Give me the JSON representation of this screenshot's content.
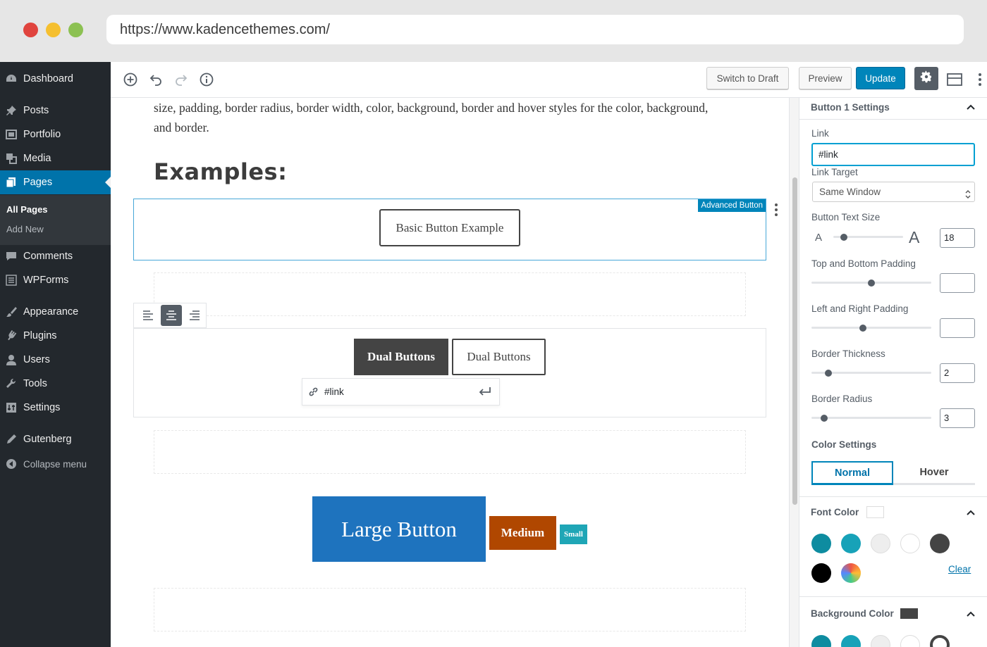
{
  "browser": {
    "url": "https://www.kadencethemes.com/",
    "dots": [
      "#e0443e",
      "#f5bf2f",
      "#8cc152"
    ]
  },
  "sidebar": {
    "items": [
      {
        "label": "Dashboard",
        "icon": "dashboard-icon"
      },
      {
        "label": "Posts",
        "icon": "pin-icon"
      },
      {
        "label": "Portfolio",
        "icon": "portfolio-icon"
      },
      {
        "label": "Media",
        "icon": "media-icon"
      },
      {
        "label": "Pages",
        "icon": "pages-icon"
      },
      {
        "label": "Comments",
        "icon": "comments-icon"
      },
      {
        "label": "WPForms",
        "icon": "forms-icon"
      },
      {
        "label": "Appearance",
        "icon": "brush-icon"
      },
      {
        "label": "Plugins",
        "icon": "plugin-icon"
      },
      {
        "label": "Users",
        "icon": "user-icon"
      },
      {
        "label": "Tools",
        "icon": "wrench-icon"
      },
      {
        "label": "Settings",
        "icon": "settings-icon"
      },
      {
        "label": "Gutenberg",
        "icon": "pencil-icon"
      },
      {
        "label": "Collapse menu",
        "icon": "collapse-icon"
      }
    ],
    "submenu": [
      "All Pages",
      "Add New"
    ]
  },
  "toolbar": {
    "switch_draft": "Switch to Draft",
    "preview": "Preview",
    "update": "Update"
  },
  "editor": {
    "paragraph": "size, padding, border radius, border width, color, background, border and hover styles for the color, background, and border.",
    "heading": "Examples:",
    "block_label": "Advanced Button",
    "basic_button": "Basic Button Example",
    "dual_button_1": "Dual Buttons",
    "dual_button_2": "Dual Buttons",
    "link_value": "#link",
    "large_button": "Large Button",
    "medium_button": "Medium",
    "small_button": "Small"
  },
  "panel": {
    "section_title": "Button 1 Settings",
    "link_label": "Link",
    "link_value": "#link",
    "link_target_label": "Link Target",
    "link_target_value": "Same Window",
    "text_size_label": "Button Text Size",
    "text_size_small_glyph": "A",
    "text_size_large_glyph": "A",
    "text_size_value": "18",
    "tb_padding_label": "Top and Bottom Padding",
    "lr_padding_label": "Left and Right Padding",
    "border_thickness_label": "Border Thickness",
    "border_thickness_value": "2",
    "border_radius_label": "Border Radius",
    "border_radius_value": "3",
    "color_settings_label": "Color Settings",
    "tab_normal": "Normal",
    "tab_hover": "Hover",
    "font_color_label": "Font Color",
    "clear_label": "Clear",
    "bg_color_label": "Background Color",
    "swatches": [
      "#0e8ca0",
      "#17a2b8",
      "#eeeeee",
      "#ffffff",
      "#444444",
      "#000000"
    ],
    "bg_swatch": "#444444"
  },
  "colors": {
    "accent": "#0085ba",
    "large_button_bg": "#1e73be",
    "medium_button_bg": "#b04700",
    "small_button_bg": "#1fa6b6",
    "dark_button_bg": "#444444"
  }
}
